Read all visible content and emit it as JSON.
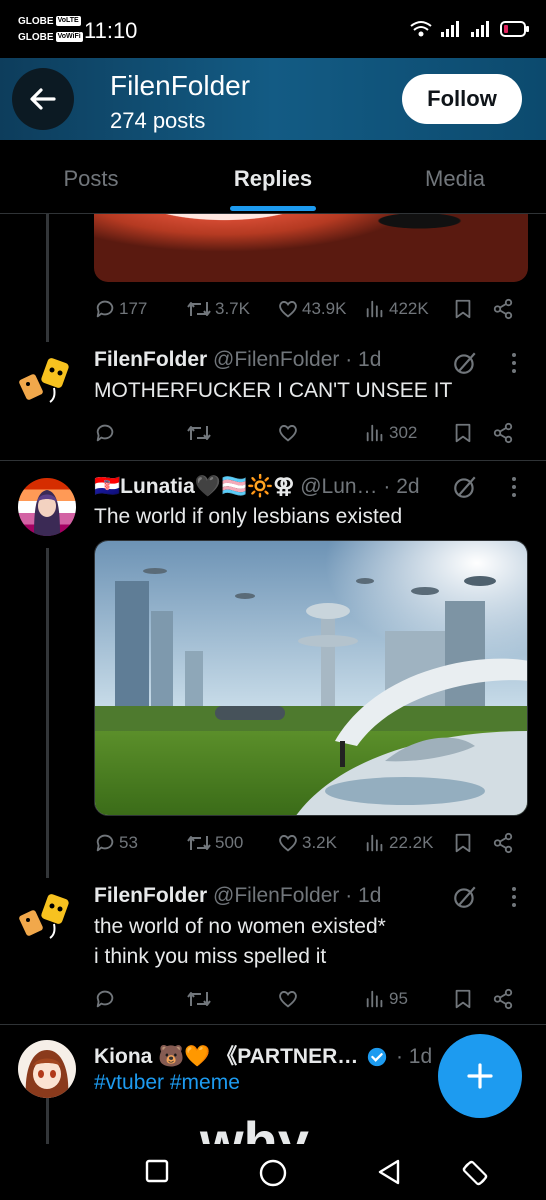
{
  "status_bar": {
    "carrier_1": "GLOBE",
    "carrier_1_badge": "VoLTE",
    "carrier_2": "GLOBE",
    "carrier_2_badge": "VoWiFi",
    "time": "11:10"
  },
  "header": {
    "name": "FilenFolder",
    "posts_count": "274 posts",
    "follow_label": "Follow"
  },
  "tabs": [
    {
      "label": "Posts",
      "active": false
    },
    {
      "label": "Replies",
      "active": true
    },
    {
      "label": "Media",
      "active": false
    }
  ],
  "posts": [
    {
      "stats": {
        "replies": "177",
        "reposts": "3.7K",
        "likes": "43.9K",
        "views": "422K"
      }
    },
    {
      "name": "FilenFolder",
      "handle_time": "@FilenFolder · 1d",
      "text": "MOTHERFUCKER I CAN'T UNSEE IT",
      "stats": {
        "replies": "",
        "reposts": "",
        "likes": "",
        "views": "302"
      }
    },
    {
      "name": "🇭🇷Lunatia🖤🏳️‍⚧️🔆⚢",
      "handle_time": "@Lun… · 2d",
      "text": "The world if only lesbians existed",
      "stats": {
        "replies": "53",
        "reposts": "500",
        "likes": "3.2K",
        "views": "22.2K"
      }
    },
    {
      "name": "FilenFolder",
      "handle_time": "@FilenFolder · 1d",
      "text": "the world of no women existed*\ni think you miss spelled it",
      "stats": {
        "replies": "",
        "reposts": "",
        "likes": "",
        "views": "95"
      }
    },
    {
      "name": "Kiona 🐻🧡 《PARTNER…",
      "handle_time": "· 1d",
      "text": "#vtuber #meme",
      "image_text": "why"
    }
  ],
  "colors": {
    "accent": "#1d9bf0",
    "header_start": "#0d3d5c",
    "header_end": "#135b84",
    "muted": "#71767b"
  }
}
